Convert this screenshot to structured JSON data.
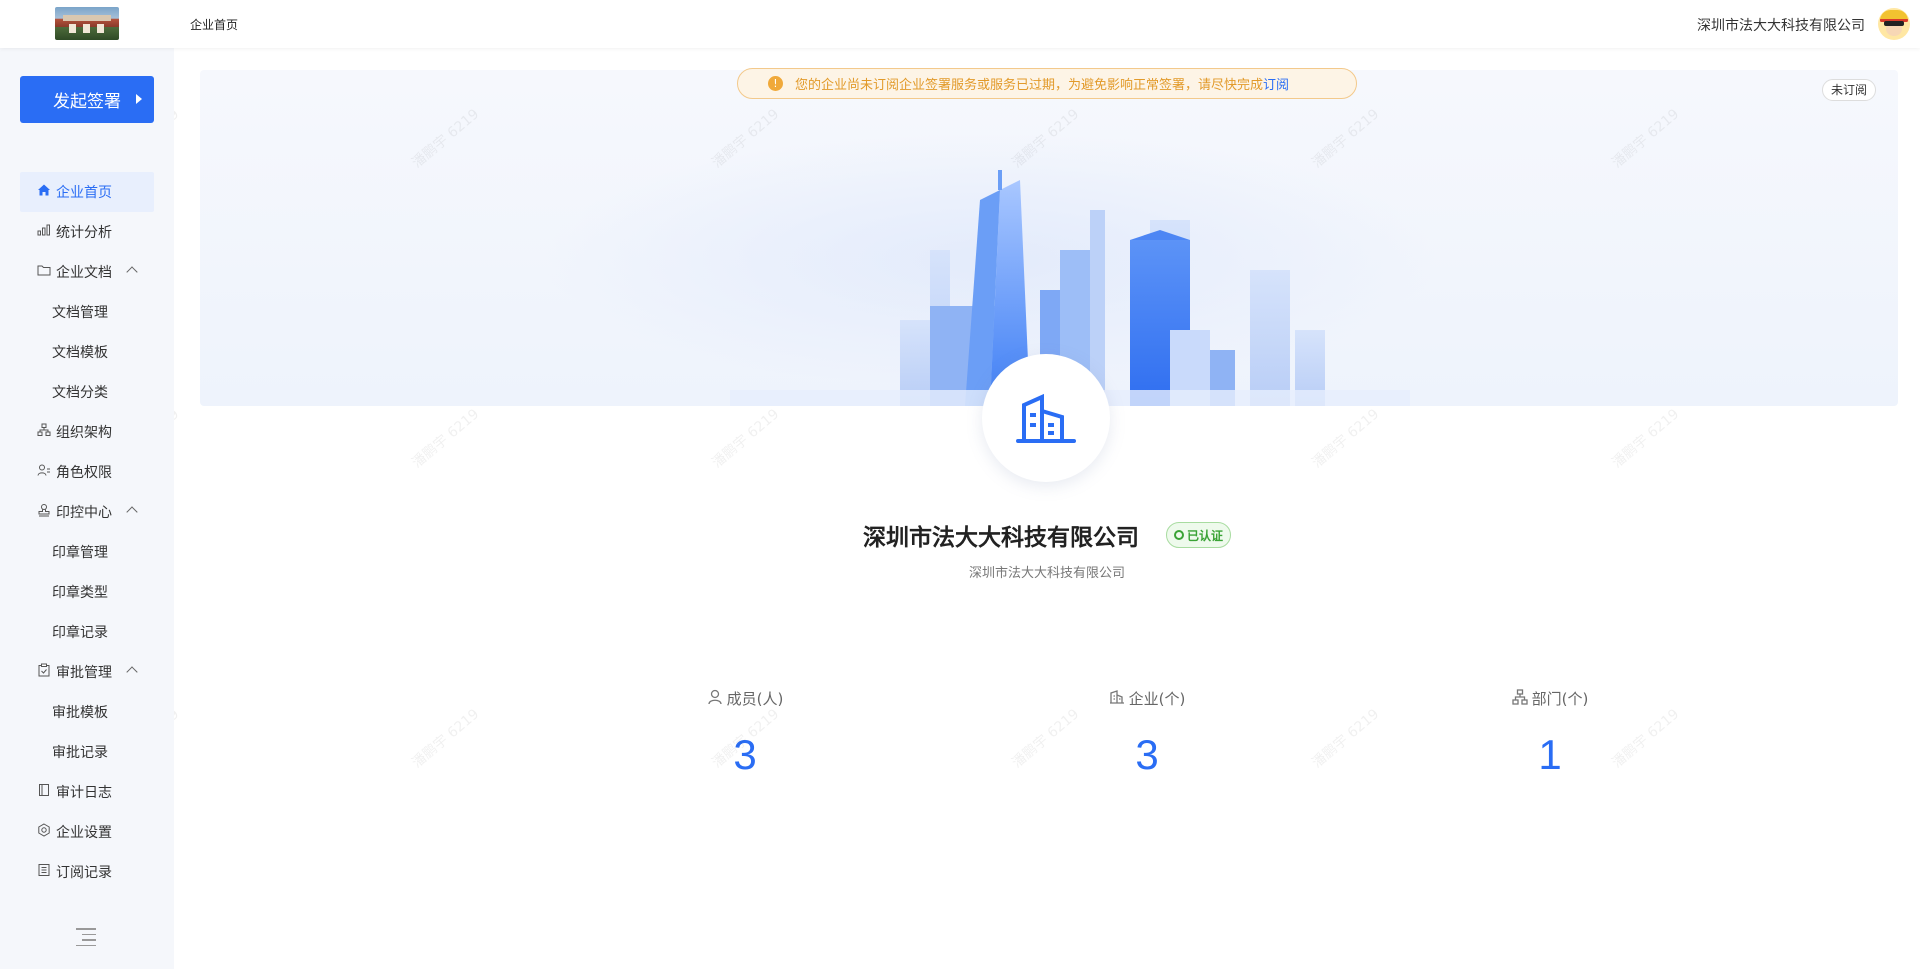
{
  "header": {
    "title": "企业首页",
    "company_name": "深圳市法大大科技有限公司"
  },
  "sidebar": {
    "start_button": "发起签署",
    "items": [
      {
        "label": "企业首页",
        "icon": "home-icon",
        "active": true
      },
      {
        "label": "统计分析",
        "icon": "bar-chart-icon"
      },
      {
        "label": "企业文档",
        "icon": "folder-icon",
        "expanded": true
      },
      {
        "label": "文档管理",
        "sub": true
      },
      {
        "label": "文档模板",
        "sub": true
      },
      {
        "label": "文档分类",
        "sub": true
      },
      {
        "label": "组织架构",
        "icon": "org-chart-icon"
      },
      {
        "label": "角色权限",
        "icon": "user-role-icon"
      },
      {
        "label": "印控中心",
        "icon": "stamp-icon",
        "expanded": true
      },
      {
        "label": "印章管理",
        "sub": true
      },
      {
        "label": "印章类型",
        "sub": true
      },
      {
        "label": "印章记录",
        "sub": true
      },
      {
        "label": "审批管理",
        "icon": "clipboard-check-icon",
        "expanded": true
      },
      {
        "label": "审批模板",
        "sub": true
      },
      {
        "label": "审批记录",
        "sub": true
      },
      {
        "label": "审计日志",
        "icon": "notebook-icon"
      },
      {
        "label": "企业设置",
        "icon": "settings-icon"
      },
      {
        "label": "订阅记录",
        "icon": "document-list-icon"
      }
    ]
  },
  "notice": {
    "text": "您的企业尚未订阅企业签署服务或服务已过期，为避免影响正常签署，请尽快完成",
    "link": "订阅"
  },
  "subscription_badge": "未订阅",
  "company": {
    "name": "深圳市法大大科技有限公司",
    "verified_label": "已认证",
    "subtitle": "深圳市法大大科技有限公司"
  },
  "stats": [
    {
      "label": "成员(人)",
      "value": "3",
      "icon": "user-icon"
    },
    {
      "label": "企业(个)",
      "value": "3",
      "icon": "building-icon"
    },
    {
      "label": "部门(个)",
      "value": "1",
      "icon": "org-chart-icon"
    }
  ],
  "watermark": "潘鹏宇 6219",
  "colors": {
    "accent": "#2a6df4",
    "warning": "#e29a2a",
    "success": "#3aa335"
  }
}
